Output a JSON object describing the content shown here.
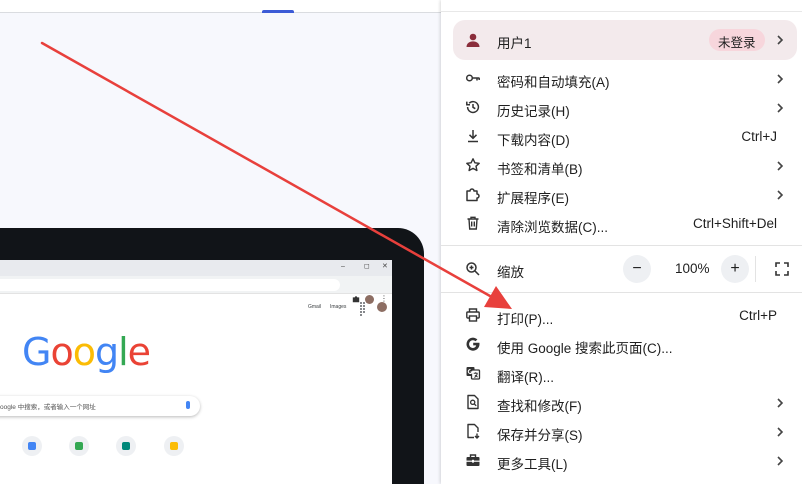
{
  "menu": {
    "profile": {
      "name": "用户1",
      "status": "未登录"
    },
    "items_group1": [
      {
        "label": "密码和自动填充(A)",
        "icon": "key-icon",
        "shortcut": "",
        "submenu": true
      },
      {
        "label": "历史记录(H)",
        "icon": "history-icon",
        "shortcut": "",
        "submenu": true
      },
      {
        "label": "下载内容(D)",
        "icon": "download-icon",
        "shortcut": "Ctrl+J",
        "submenu": false
      },
      {
        "label": "书签和清单(B)",
        "icon": "star-icon",
        "shortcut": "",
        "submenu": true
      },
      {
        "label": "扩展程序(E)",
        "icon": "extension-icon",
        "shortcut": "",
        "submenu": true
      },
      {
        "label": "清除浏览数据(C)...",
        "icon": "trash-icon",
        "shortcut": "Ctrl+Shift+Del",
        "submenu": false
      }
    ],
    "zoom": {
      "label": "缩放",
      "minus": "−",
      "value": "100%",
      "plus": "+"
    },
    "items_group2": [
      {
        "label": "打印(P)...",
        "icon": "print-icon",
        "shortcut": "Ctrl+P",
        "submenu": false
      },
      {
        "label": "使用 Google 搜索此页面(C)...",
        "icon": "google-g-icon",
        "shortcut": "",
        "submenu": false
      },
      {
        "label": "翻译(R)...",
        "icon": "translate-icon",
        "shortcut": "",
        "submenu": false
      },
      {
        "label": "查找和修改(F)",
        "icon": "find-page-icon",
        "shortcut": "",
        "submenu": true
      },
      {
        "label": "保存并分享(S)",
        "icon": "save-share-icon",
        "shortcut": "",
        "submenu": true
      },
      {
        "label": "更多工具(L)",
        "icon": "toolbox-icon",
        "shortcut": "",
        "submenu": true
      }
    ]
  },
  "preview": {
    "gmail_link": "Gmail",
    "images_link": "Images",
    "google_logo": [
      "G",
      "o",
      "o",
      "g",
      "l",
      "e"
    ],
    "logo_colors": [
      "#4285F4",
      "#EA4335",
      "#FBBC05",
      "#4285F4",
      "#34A853",
      "#EA4335"
    ],
    "search_placeholder": "oogle 中搜索，或者输入一个网址",
    "window_controls": [
      "–",
      "◻",
      "✕"
    ]
  },
  "colors": {
    "accent": "#3c5bd6",
    "profile_bg": "#f3eaec",
    "status_bg": "#f7d6dc",
    "annotation_arrow": "#e8403c"
  }
}
